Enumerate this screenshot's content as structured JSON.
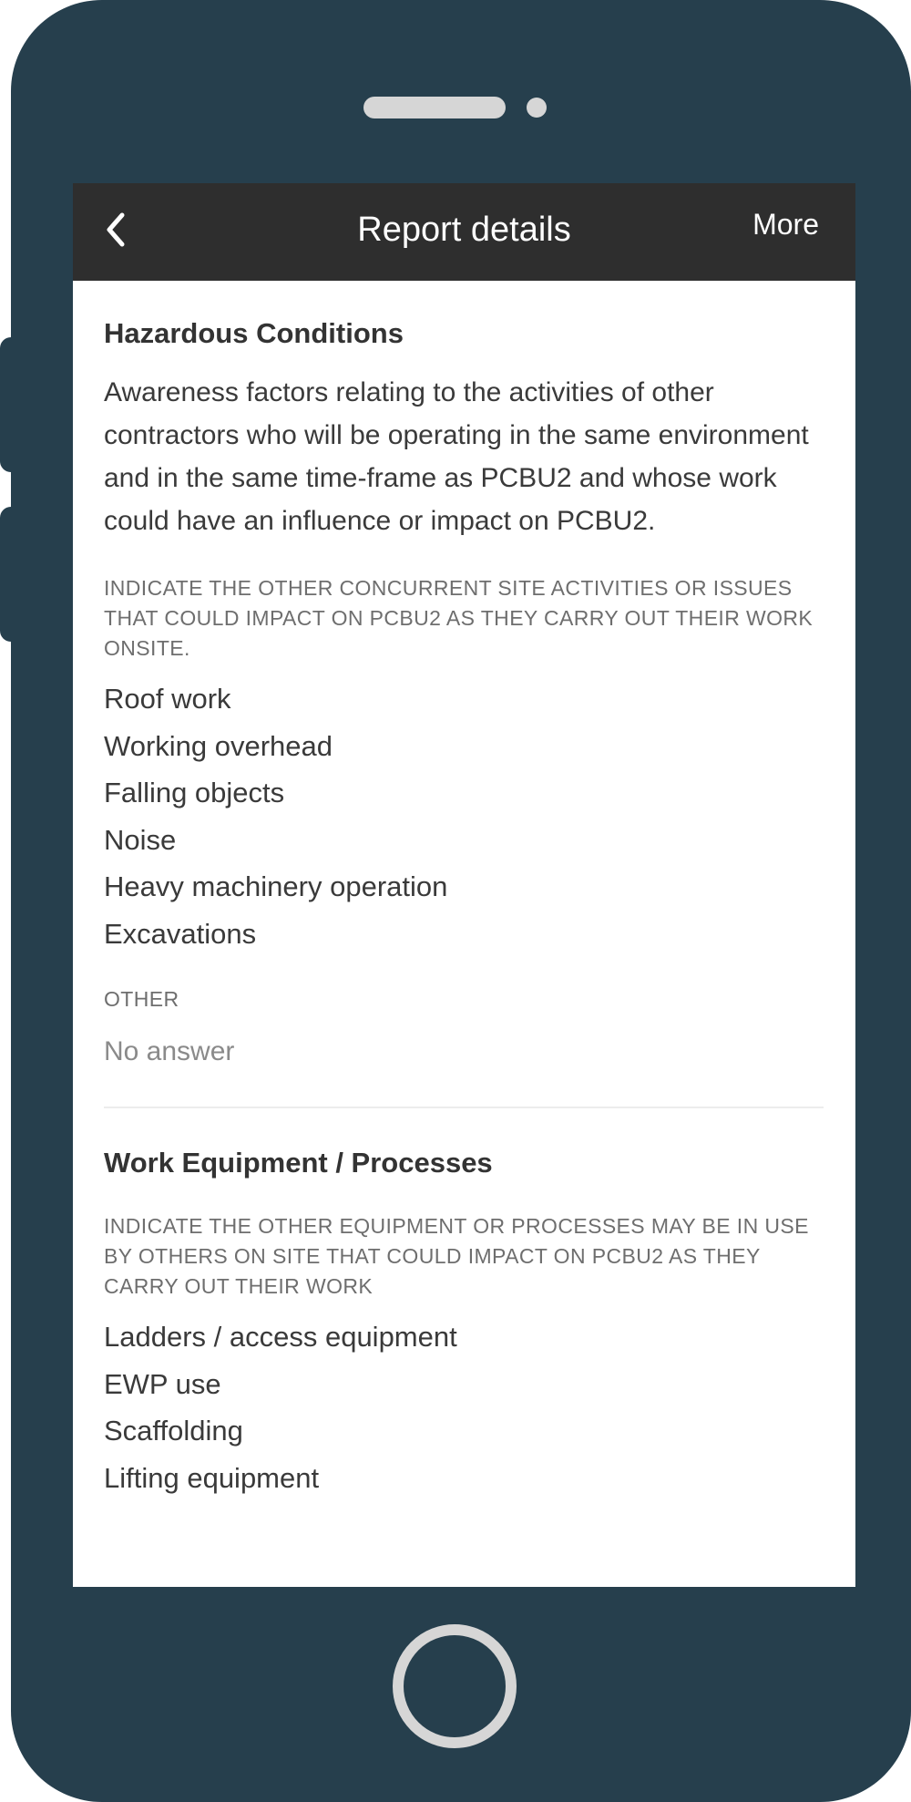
{
  "header": {
    "title": "Report details",
    "more_label": "More"
  },
  "sections": [
    {
      "title": "Hazardous Conditions",
      "description": "Awareness factors relating to the activities of other contractors who will be operating in the same environment and in the same time-frame as PCBU2 and whose work could have an influence or impact on PCBU2.",
      "question": "INDICATE THE OTHER CONCURRENT SITE ACTIVITIES OR ISSUES THAT COULD IMPACT ON PCBU2 AS THEY CARRY OUT THEIR WORK ONSITE.",
      "answers": [
        "Roof work",
        "Working overhead",
        "Falling objects",
        "Noise",
        "Heavy machinery operation",
        "Excavations"
      ],
      "other_label": "OTHER",
      "other_value": "No answer"
    },
    {
      "title": "Work Equipment / Processes",
      "question": "INDICATE THE OTHER EQUIPMENT OR PROCESSES MAY BE IN USE BY OTHERS ON SITE THAT COULD IMPACT ON PCBU2 AS THEY CARRY OUT THEIR WORK",
      "answers": [
        "Ladders / access equipment",
        "EWP use",
        "Scaffolding",
        "Lifting equipment"
      ]
    }
  ],
  "icons": {
    "back": "chevron-left-icon"
  },
  "colors": {
    "navbar": "#2e2e2e",
    "device": "#263f4d"
  }
}
